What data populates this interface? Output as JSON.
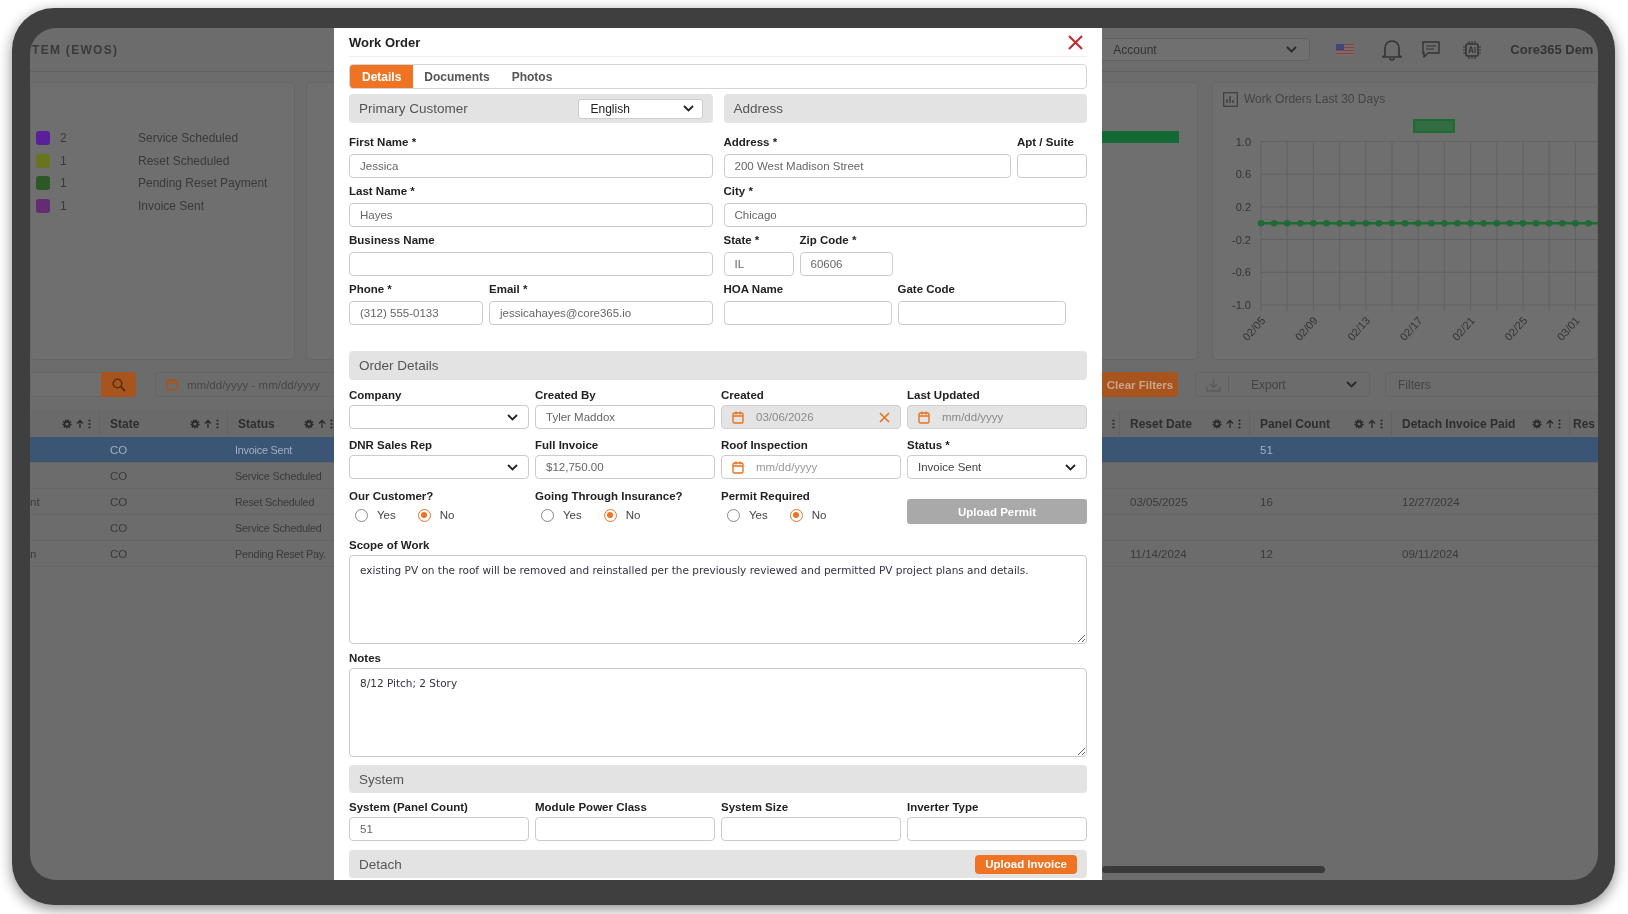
{
  "screen": {
    "app_title": "TEM (EWOS)",
    "account_select": "Account",
    "user_name": "Core365 Dem"
  },
  "status_legend": [
    {
      "count": "2",
      "label": "Service Scheduled",
      "color": "#5a1f99"
    },
    {
      "count": "1",
      "label": "Reset Scheduled",
      "color": "#69751c"
    },
    {
      "count": "1",
      "label": "Pending Reset Payment",
      "color": "#2d5726"
    },
    {
      "count": "1",
      "label": "Invoice Sent",
      "color": "#642c72"
    }
  ],
  "orders_chart": {
    "title": "Work Orders Last 30 Days",
    "chart_data": {
      "type": "line",
      "categories": [
        "02/05",
        null,
        null,
        null,
        "02/09",
        null,
        null,
        null,
        "02/13",
        null,
        null,
        null,
        "02/17",
        null,
        null,
        null,
        "02/21",
        null,
        null,
        null,
        "02/25",
        null,
        null,
        null,
        "03/01",
        null,
        null
      ],
      "series": [
        {
          "color": "#1e6b34",
          "marker": "circle",
          "values": [
            0,
            0,
            0,
            0,
            0,
            0,
            0,
            0,
            0,
            0,
            0,
            0,
            0,
            0,
            0,
            0,
            0,
            0,
            0,
            0,
            0,
            0,
            0,
            0,
            0,
            0,
            0
          ]
        }
      ],
      "grid": true,
      "ylim": [
        -1,
        1
      ],
      "yticks": [
        {
          "value": 1,
          "label": "1.0"
        },
        {
          "value": 0.6,
          "label": "0.6"
        },
        {
          "value": 0.2,
          "label": "0.2"
        },
        {
          "value": -0.2,
          "label": "-0.2"
        },
        {
          "value": -0.6,
          "label": "-0.6"
        },
        {
          "value": -1,
          "label": "-1.0"
        }
      ]
    }
  },
  "toolbar": {
    "date_range_placeholder": "mm/dd/yyyy - mm/dd/yyyy",
    "clear_filters": "Clear Filters",
    "export": "Export",
    "filters_placeholder": "Filters"
  },
  "table": {
    "columns": [
      "State",
      "Status",
      "Reset Date",
      "Panel Count",
      "Detach Invoice Paid",
      "Res"
    ],
    "rows": [
      {
        "selected": true,
        "state": "CO",
        "status": "Invoice Sent",
        "panel_count": "51"
      },
      {
        "selected": false,
        "state": "CO",
        "status": "Service Scheduled"
      },
      {
        "selected": false,
        "column_1": "nt",
        "state": "CO",
        "status": "Reset Scheduled",
        "reset_date": "03/05/2025",
        "panel_count": "16",
        "detach_invoice_paid": "12/27/2024"
      },
      {
        "selected": false,
        "state": "CO",
        "status": "Service Scheduled"
      },
      {
        "selected": false,
        "column_1": "n",
        "state": "CO",
        "status": "Pending Reset Pay.",
        "reset_date": "11/14/2024",
        "panel_count": "12",
        "detach_invoice_paid": "09/11/2024"
      }
    ]
  },
  "work_order": {
    "title": "Work Order",
    "tabs": [
      {
        "label": "Details",
        "selected": true
      },
      {
        "label": "Documents",
        "selected": false
      },
      {
        "label": "Photos",
        "selected": false
      }
    ],
    "primary_customer": {
      "heading": "Primary Customer",
      "language": "English",
      "first_name": {
        "label": "First Name *",
        "value": "Jessica"
      },
      "last_name": {
        "label": "Last Name *",
        "value": "Hayes"
      },
      "business_name": {
        "label": "Business Name"
      },
      "phone": {
        "label": "Phone *",
        "value": "(312) 555-0133"
      },
      "email": {
        "label": "Email *",
        "value": "jessicahayes@core365.io"
      }
    },
    "address": {
      "heading": "Address",
      "address": {
        "label": "Address *",
        "value": "200 West Madison Street"
      },
      "apt_suite": {
        "label": "Apt / Suite"
      },
      "city": {
        "label": "City *",
        "value": "Chicago"
      },
      "state": {
        "label": "State *",
        "value": "IL"
      },
      "zip_code": {
        "label": "Zip Code *",
        "value": "60606"
      },
      "hoa_name": {
        "label": "HOA Name"
      },
      "gate_code": {
        "label": "Gate Code"
      }
    },
    "order_details": {
      "heading": "Order Details",
      "fields": [
        {
          "kind": "select",
          "label": "Company"
        },
        {
          "kind": "text",
          "label": "Created By",
          "value": "Tyler Maddox"
        },
        {
          "kind": "date",
          "label": "Created",
          "value": "03/06/2026",
          "disabled": true,
          "clearable": true
        },
        {
          "kind": "date",
          "label": "Last Updated",
          "placeholder": "mm/dd/yyyy",
          "disabled": true,
          "clearable": false
        },
        {
          "kind": "select",
          "label": "DNR Sales Rep"
        },
        {
          "kind": "text",
          "label": "Full Invoice",
          "value": "$12,750.00"
        },
        {
          "kind": "date",
          "label": "Roof Inspection",
          "placeholder": "mm/dd/yyyy",
          "disabled": false,
          "clearable": false
        },
        {
          "kind": "select",
          "label": "Status *",
          "value": "Invoice Sent"
        }
      ],
      "radio_groups": [
        {
          "label": "Our Customer?",
          "options": [
            {
              "label": "Yes",
              "selected": false
            },
            {
              "label": "No",
              "selected": true
            }
          ]
        },
        {
          "label": "Going Through Insurance?",
          "options": [
            {
              "label": "Yes",
              "selected": false
            },
            {
              "label": "No",
              "selected": true
            }
          ]
        },
        {
          "label": "Permit Required",
          "options": [
            {
              "label": "Yes",
              "selected": false
            },
            {
              "label": "No",
              "selected": true
            }
          ]
        }
      ],
      "upload_permit": {
        "label": "Upload Permit",
        "disabled": true
      }
    },
    "scope_of_work": {
      "label": "Scope of Work",
      "value": "existing PV on the roof will be removed and reinstalled per the previously reviewed and permitted PV project plans and details."
    },
    "notes": {
      "label": "Notes",
      "value": "8/12 Pitch; 2 Story"
    },
    "system": {
      "heading": "System",
      "fields": [
        {
          "label": "System (Panel Count)",
          "value": "51"
        },
        {
          "label": "Module Power Class"
        },
        {
          "label": "System Size"
        },
        {
          "label": "Inverter Type"
        }
      ]
    },
    "detach": {
      "heading": "Detach",
      "upload_button": "Upload Invoice"
    }
  }
}
